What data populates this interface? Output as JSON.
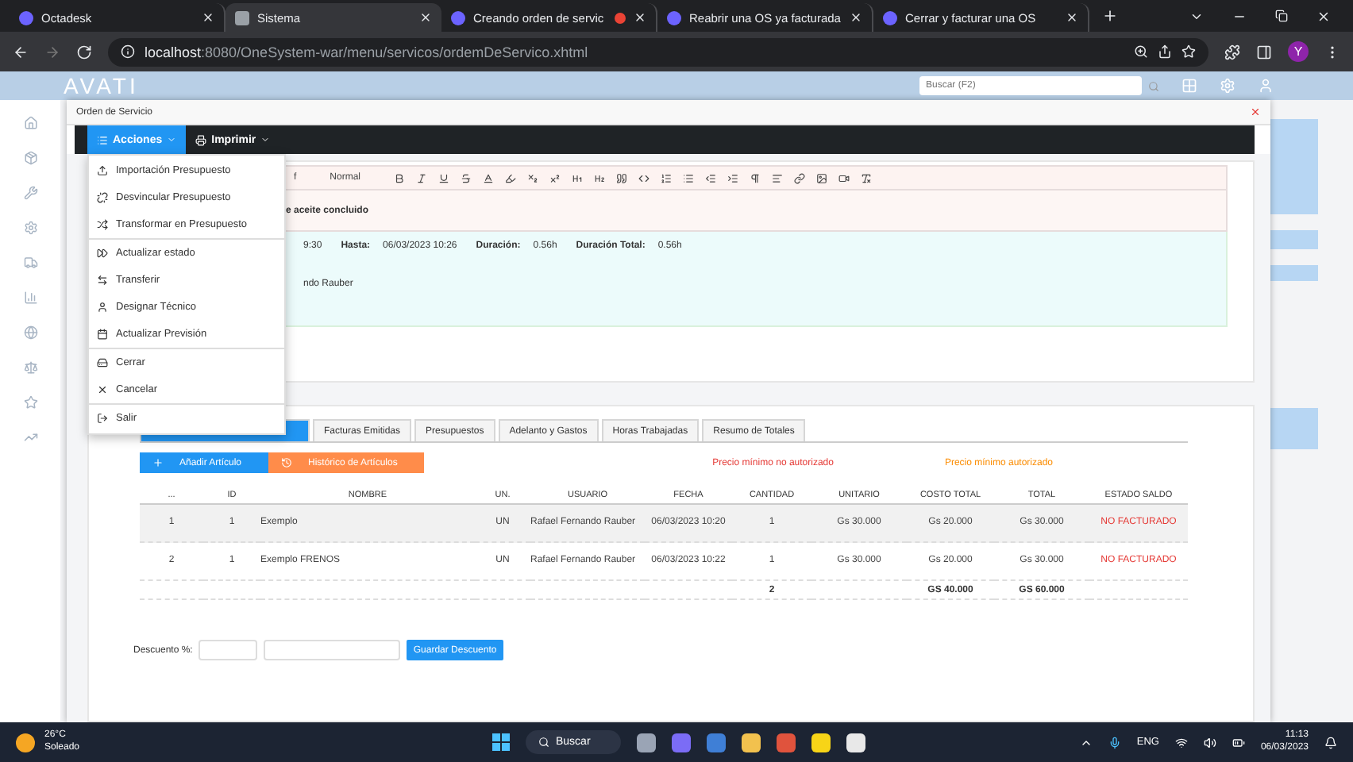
{
  "browser": {
    "tabs": [
      {
        "title": "Octadesk",
        "selected": false,
        "recording": false
      },
      {
        "title": "Sistema",
        "selected": true,
        "recording": false
      },
      {
        "title": "Creando orden de servic",
        "selected": false,
        "recording": true
      },
      {
        "title": "Reabrir una OS ya facturada",
        "selected": false,
        "recording": false
      },
      {
        "title": "Cerrar y facturar una OS",
        "selected": false,
        "recording": false
      }
    ],
    "url_host": "localhost",
    "url_path": ":8080/OneSystem-war/menu/servicos/ordemDeServico.xhtml",
    "profile_initial": "Y"
  },
  "app": {
    "logo": "AVATI",
    "search": {
      "placeholder": "Buscar (F2)"
    }
  },
  "dialog": {
    "title": "Orden de Servicio",
    "toolbar": [
      {
        "label": "Acciones",
        "selected": true
      },
      {
        "label": "Imprimir",
        "selected": false
      }
    ],
    "actions_menu": [
      [
        "Importación Presupuesto",
        "Desvincular Presupuesto",
        "Transformar en Presupuesto"
      ],
      [
        "Actualizar estado",
        "Transferir",
        "Designar Técnico",
        "Actualizar Previsión"
      ],
      [
        "Cerrar",
        "Cancelar"
      ],
      [
        "Salir"
      ]
    ],
    "editor": {
      "font": "f",
      "size": "Normal",
      "text": "e aceite concluido"
    },
    "time_info": [
      {
        "value": "9:30"
      },
      {
        "label": "Hasta:",
        "value": "06/03/2023 10:26"
      },
      {
        "label": "Duración:",
        "value": "0.56h"
      },
      {
        "label": "Duración Total:",
        "value": "0.56h"
      }
    ],
    "responsible": "ndo Rauber",
    "tabs": [
      {
        "selected": true
      },
      {
        "label": "Facturas Emitidas",
        "selected": false
      },
      {
        "label": "Presupuestos",
        "selected": false
      },
      {
        "label": "Adelanto y Gastos",
        "selected": false
      },
      {
        "label": "Horas Trabajadas",
        "selected": false
      },
      {
        "label": "Resumo de Totales",
        "selected": false
      }
    ],
    "buttons": [
      {
        "kind": "add",
        "label": "Añadir Artículo"
      },
      {
        "kind": "history",
        "label": "Histórico de Artículos"
      }
    ],
    "legend": [
      {
        "label": "Precio mínimo no autorizado",
        "color": "#e53935"
      },
      {
        "label": "Precio mínimo autorizado",
        "color": "#fb8c00"
      }
    ],
    "table": {
      "columns": [
        "...",
        "ID",
        "NOMBRE",
        "UN.",
        "USUARIO",
        "FECHA",
        "CANTIDAD",
        "UNITARIO",
        "COSTO TOTAL",
        "TOTAL",
        "ESTADO SALDO"
      ],
      "rows": [
        [
          "1",
          "1",
          "Exemplo",
          "UN",
          "Rafael Fernando Rauber",
          "06/03/2023 10:20",
          "1",
          "Gs 30.000",
          "Gs 20.000",
          "Gs 30.000",
          "NO FACTURADO"
        ],
        [
          "2",
          "1",
          "Exemplo FRENOS",
          "UN",
          "Rafael Fernando Rauber",
          "06/03/2023 10:22",
          "1",
          "Gs 30.000",
          "Gs 20.000",
          "Gs 30.000",
          "NO FACTURADO"
        ]
      ],
      "totals": {
        "cantidad": "2",
        "costo_total": "GS 40.000",
        "total": "GS 60.000"
      }
    },
    "discount": {
      "label": "Descuento %:",
      "button": "Guardar Descuento"
    }
  },
  "taskbar": {
    "weather": {
      "temp": "26°C",
      "condition": "Soleado"
    },
    "search": "Buscar",
    "language": "ENG",
    "time": "11:13",
    "date": "06/03/2023"
  }
}
